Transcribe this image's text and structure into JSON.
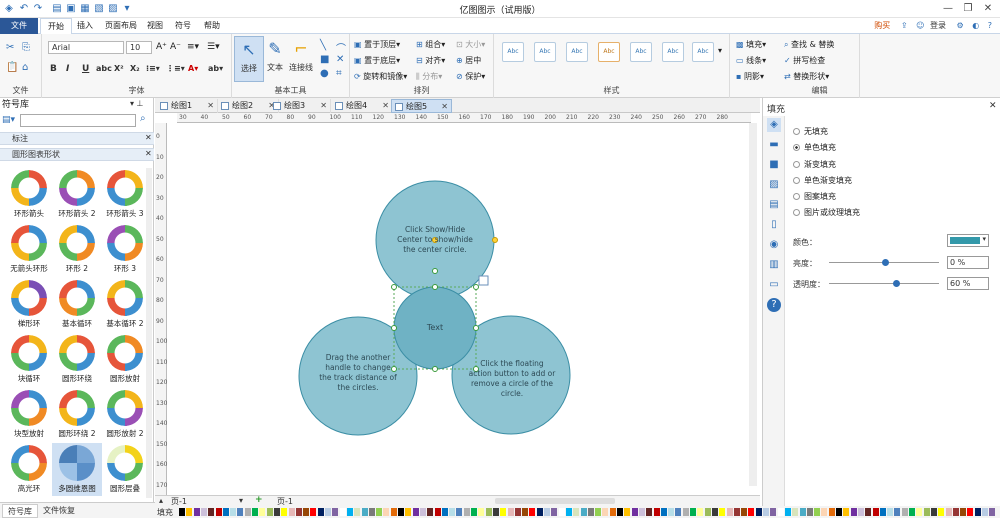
{
  "window": {
    "title": "亿图图示（试用版）"
  },
  "menu": {
    "file": "文件",
    "items": [
      "开始",
      "插入",
      "页面布局",
      "视图",
      "符号",
      "帮助"
    ],
    "right": {
      "buy": "购买",
      "login": "登录"
    }
  },
  "ribbon": {
    "font_name": "Arial",
    "font_size": "10",
    "groups": {
      "file": "文件",
      "font": "字体",
      "tools": "基本工具",
      "arrange": "排列",
      "style": "样式",
      "edit": "编辑"
    },
    "tools": {
      "select": "选择",
      "text": "文本",
      "connector": "连接线"
    },
    "arrange": {
      "front": "置于顶层",
      "back": "置于底层",
      "rotate": "旋转和镜像",
      "group": "组合",
      "align": "对齐",
      "distribute": "分布",
      "size": "大小",
      "center": "居中",
      "protect": "保护"
    },
    "style_label": "Abc",
    "fill_items": {
      "fill": "填充",
      "line": "线条",
      "shadow": "阴影"
    },
    "edit": {
      "find": "查找 & 替换",
      "spell": "拼写检查",
      "replace_shape": "替换形状"
    }
  },
  "library": {
    "title": "符号库",
    "search_placeholder": "",
    "sections": [
      "标注",
      "圆形图表形状"
    ],
    "shapes": [
      "环形箭头",
      "环形箭头 2",
      "环形箭头 3",
      "无箭头环形",
      "环形 2",
      "环形 3",
      "梯形环",
      "基本循环",
      "基本循环 2",
      "块循环",
      "圆形环绕",
      "圆形放射",
      "块型放射",
      "圆形环绕 2",
      "圆形放射 2",
      "高光环",
      "多圆维恩图",
      "圆形层叠"
    ]
  },
  "tabs": [
    "绘图1",
    "绘图2",
    "绘图3",
    "绘图4",
    "绘图5"
  ],
  "active_tab": 4,
  "ruler_h": [
    "30",
    "40",
    "50",
    "60",
    "70",
    "80",
    "90",
    "100",
    "110",
    "120",
    "130",
    "140",
    "150",
    "160",
    "170",
    "180",
    "190",
    "200",
    "210",
    "220",
    "230",
    "240",
    "250",
    "260",
    "270",
    "280"
  ],
  "ruler_v": [
    "0",
    "10",
    "20",
    "30",
    "40",
    "50",
    "60",
    "70",
    "80",
    "90",
    "100",
    "110",
    "120",
    "130",
    "140",
    "150",
    "160",
    "170"
  ],
  "canvas": {
    "circle_top": "Click Show/Hide Center to show/hide the center circle.",
    "circle_left": "Drag the another handle to change the track distance of the circles.",
    "circle_right": "Click the floating action button to add or remove a circle of the circle.",
    "center": "Text",
    "fill_color": "#3399aa"
  },
  "fill_panel": {
    "title": "填充",
    "options": [
      "无填充",
      "单色填充",
      "渐变填充",
      "单色渐变填充",
      "图案填充",
      "图片或纹理填充"
    ],
    "selected": 1,
    "color_label": "颜色：",
    "brightness_label": "亮度：",
    "brightness": "0 %",
    "transparency_label": "透明度：",
    "transparency": "60 %"
  },
  "status": {
    "page_select": "页-1",
    "page_tab": "页-1",
    "fill_label": "填充"
  },
  "bottom_tabs": [
    "符号库",
    "文件恢复"
  ]
}
